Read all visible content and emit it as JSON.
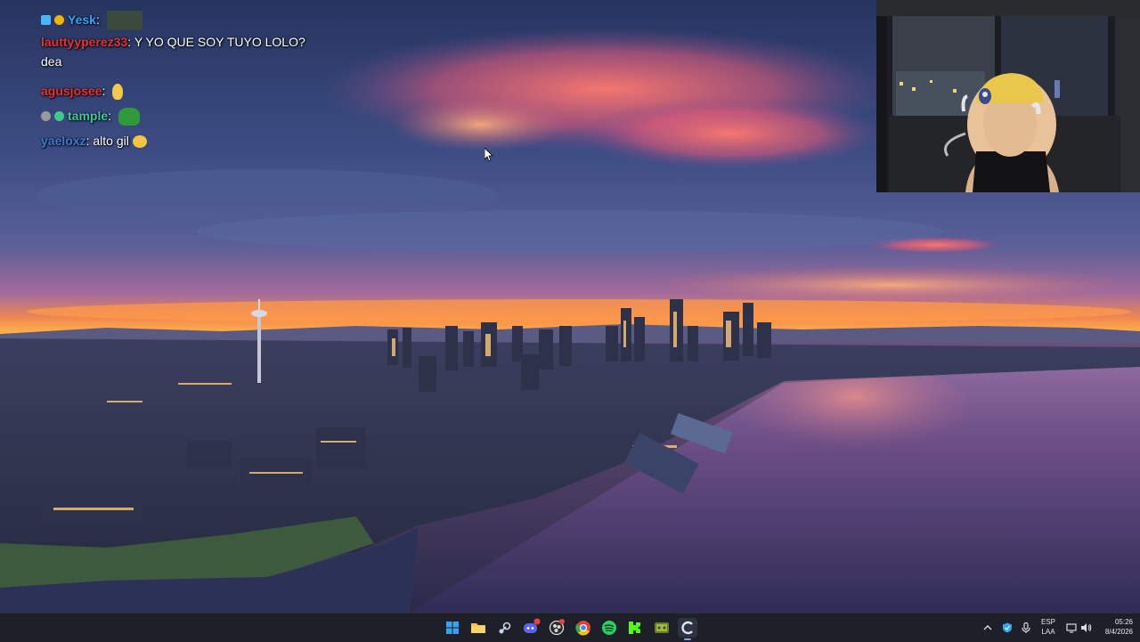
{
  "chat": {
    "messages": [
      {
        "user": "Yesk",
        "text": "",
        "user_color": "#2ea8ff",
        "emote": "photo-emote"
      },
      {
        "user": "lauttyyperez33",
        "text": "Y YO QUE SOY TUYO LOLO?",
        "text2": "dea",
        "user_color": "#e8312f"
      },
      {
        "user": "agusjosee",
        "text": "",
        "user_color": "#e8312f",
        "emote": "banana-emote"
      },
      {
        "user": "tample",
        "text": "",
        "user_color": "#3ec9a0",
        "emote": "frog-emote"
      },
      {
        "user": "yaeloxz",
        "text": "alto gil",
        "user_color": "#3a7bd5",
        "emote": "face-emote"
      }
    ],
    "separator": ": "
  },
  "taskbar": {
    "apps": [
      {
        "name": "start-icon",
        "color": "#2aa4f4"
      },
      {
        "name": "file-explorer-icon",
        "color": "#f3c14b"
      },
      {
        "name": "steam-icon",
        "color": "#c9d4e6"
      },
      {
        "name": "discord-icon",
        "color": "#5865f2",
        "badge": "22"
      },
      {
        "name": "obs-icon",
        "color": "#d9d9d9"
      },
      {
        "name": "chrome-icon",
        "color": "#e44134"
      },
      {
        "name": "spotify-icon",
        "color": "#1ed760"
      },
      {
        "name": "kick-icon",
        "color": "#53fc18"
      },
      {
        "name": "game-app-icon",
        "color": "#9dbb3a"
      },
      {
        "name": "edge-app-icon",
        "color": "#2a6cd6"
      }
    ],
    "tray": {
      "lang_top": "ESP",
      "lang_bottom": "LAA",
      "time": "05:26",
      "date": "8/4/2026"
    }
  }
}
